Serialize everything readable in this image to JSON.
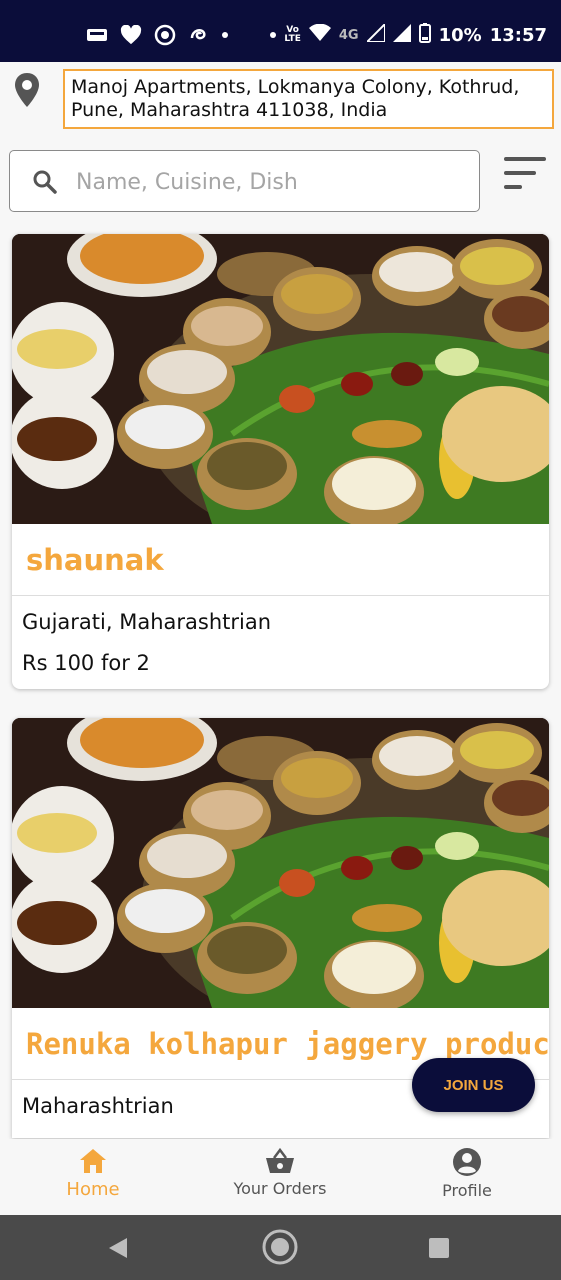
{
  "status_bar": {
    "time": "13:57",
    "battery": "10%",
    "network": "4G",
    "volte_top": "Vo",
    "volte_bottom": "LTE"
  },
  "location": {
    "icon": "map-pin-icon",
    "address": "Manoj Apartments, Lokmanya Colony, Kothrud, Pune, Maharashtra 411038, India"
  },
  "search": {
    "placeholder": "Name, Cuisine, Dish",
    "value": ""
  },
  "restaurants": [
    {
      "name": "shaunak",
      "cuisine": "Gujarati, Maharashtrian",
      "price": "Rs 100 for 2"
    },
    {
      "name": "Renuka kolhapur jaggery products",
      "cuisine": "Maharashtrian",
      "price": ""
    }
  ],
  "join_button": "JOIN US",
  "bottom_nav": [
    {
      "label": "Home",
      "icon": "home-icon",
      "active": true
    },
    {
      "label": "Your Orders",
      "icon": "basket-icon",
      "active": false
    },
    {
      "label": "Profile",
      "icon": "account-circle-icon",
      "active": false
    }
  ],
  "colors": {
    "accent": "#f4a73d",
    "navy": "#0b0d3a",
    "system_nav": "#4a4a4a"
  }
}
